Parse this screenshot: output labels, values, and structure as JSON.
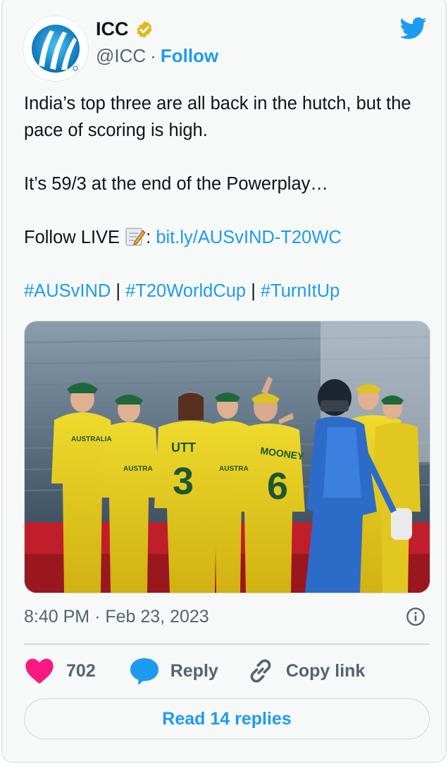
{
  "author": {
    "name": "ICC",
    "handle": "@ICC",
    "separator": "·",
    "follow_label": "Follow",
    "verified_color": "#e2b719",
    "avatar_icon": "icc-logo-icon"
  },
  "tweet": {
    "line1": "India’s top three are all back in the hutch, but the pace of scoring is high.",
    "line2": "It’s 59/3 at the end of the Powerplay…",
    "follow_live_prefix": "Follow LIVE ",
    "follow_live_colon": ": ",
    "link": "bit.ly/AUSvIND-T20WC",
    "hashtags": [
      "#AUSvIND",
      "#T20WorldCup",
      "#TurnItUp"
    ],
    "hashtag_separator": " | "
  },
  "photo": {
    "jersey_names": [
      "UTT",
      "MOONEY",
      "AUSTRALIA",
      "AUSTRA",
      "AUSTRA"
    ],
    "jersey_numbers": [
      "3",
      "6"
    ]
  },
  "meta": {
    "time": "8:40 PM",
    "separator": "·",
    "date": "Feb 23, 2023"
  },
  "actions": {
    "likes": "702",
    "reply_label": "Reply",
    "copy_link_label": "Copy link"
  },
  "footer": {
    "read_replies_label": "Read 14 replies"
  },
  "colors": {
    "accent": "#1d9bf0",
    "like": "#f91880",
    "muted": "#536471",
    "border": "#cfd9de"
  }
}
